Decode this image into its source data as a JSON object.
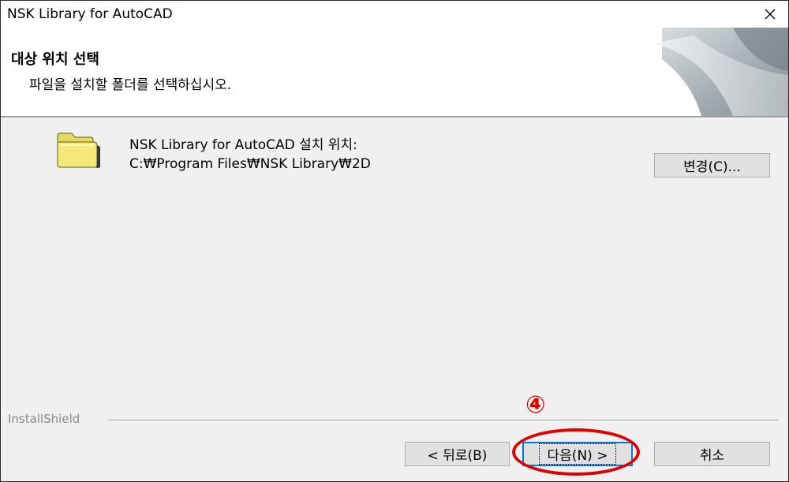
{
  "window": {
    "title": "NSK Library for AutoCAD",
    "close_symbol": "×"
  },
  "header": {
    "title": "대상 위치 선택",
    "subtitle": "파일을 설치할 폴더를 선택하십시오."
  },
  "destination": {
    "label": "NSK Library for AutoCAD 설치 위치:",
    "path": "C:₩Program Files₩NSK Library₩2D"
  },
  "buttons": {
    "change": "변경(C)...",
    "back": "< 뒤로(B)",
    "next": "다음(N) >",
    "cancel": "취소"
  },
  "footer": {
    "brand": "InstallShield"
  },
  "annotation": {
    "step": "④",
    "color": "#e00000"
  },
  "colors": {
    "accent": "#0078d7",
    "folder_yellow": "#f5e97a"
  }
}
